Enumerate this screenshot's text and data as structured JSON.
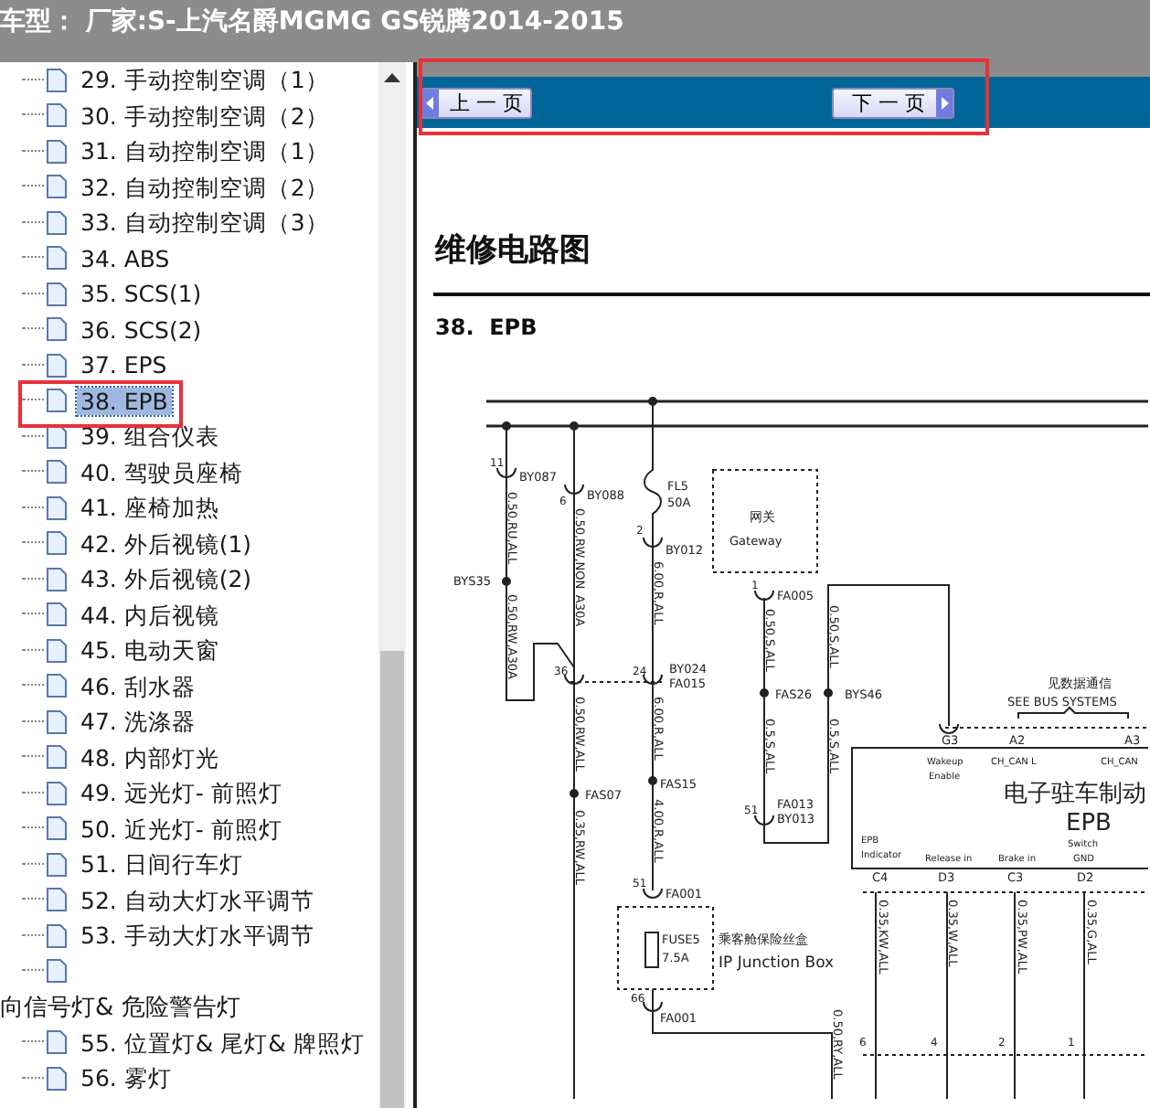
{
  "window": {
    "title": "车型： 厂家:S-上汽名爵MGMG GS锐腾2014-2015"
  },
  "tree": {
    "items": [
      {
        "label": "29. 手动控制空调（1）",
        "selected": false
      },
      {
        "label": "30. 手动控制空调（2）",
        "selected": false
      },
      {
        "label": "31. 自动控制空调（1）",
        "selected": false
      },
      {
        "label": "32. 自动控制空调（2）",
        "selected": false
      },
      {
        "label": "33. 自动控制空调（3）",
        "selected": false
      },
      {
        "label": "34. ABS",
        "selected": false
      },
      {
        "label": "35. SCS(1)",
        "selected": false
      },
      {
        "label": "36. SCS(2)",
        "selected": false
      },
      {
        "label": "37. EPS",
        "selected": false
      },
      {
        "label": "38. EPB",
        "selected": true
      },
      {
        "label": "39. 组合仪表",
        "selected": false
      },
      {
        "label": "40. 驾驶员座椅",
        "selected": false
      },
      {
        "label": "41. 座椅加热",
        "selected": false
      },
      {
        "label": "42. 外后视镜(1)",
        "selected": false
      },
      {
        "label": "43. 外后视镜(2)",
        "selected": false
      },
      {
        "label": "44. 内后视镜",
        "selected": false
      },
      {
        "label": "45. 电动天窗",
        "selected": false
      },
      {
        "label": "46. 刮水器",
        "selected": false
      },
      {
        "label": "47. 洗涤器",
        "selected": false
      },
      {
        "label": "48. 内部灯光",
        "selected": false
      },
      {
        "label": "49. 远光灯- 前照灯",
        "selected": false
      },
      {
        "label": "50. 近光灯- 前照灯",
        "selected": false
      },
      {
        "label": "51. 日间行车灯",
        "selected": false
      },
      {
        "label": "52. 自动大灯水平调节",
        "selected": false
      },
      {
        "label": "53. 手动大灯水平调节",
        "selected": false
      },
      {
        "selected": false
      },
      {
        "label": "向信号灯& 危险警告灯",
        "selected": false,
        "children": [
          {
            "label": "55. 位置灯& 尾灯& 牌照灯",
            "selected": false
          },
          {
            "label": "56. 雾灯",
            "selected": false
          }
        ]
      }
    ]
  },
  "nav": {
    "prev": "上 一 页",
    "next": "下 一 页"
  },
  "document": {
    "heading": "维修电路图",
    "section": "38.  EPB",
    "diagram": {
      "labels": [
        {
          "text": "11",
          "kind": "small"
        },
        {
          "text": "BY087",
          "kind": "plain"
        },
        {
          "text": "0.50,RU,ALL",
          "kind": "rot"
        },
        {
          "text": "BYS35",
          "kind": "plain"
        },
        {
          "text": "0.50,RW,A30A",
          "kind": "rot"
        },
        {
          "text": "6",
          "kind": "small"
        },
        {
          "text": "BY088",
          "kind": "plain"
        },
        {
          "text": "0.50,RW,NON_A30A",
          "kind": "rot"
        },
        {
          "text": "FL5",
          "kind": "plain"
        },
        {
          "text": "50A",
          "kind": "plain"
        },
        {
          "text": "2",
          "kind": "small"
        },
        {
          "text": "BY012",
          "kind": "plain"
        },
        {
          "text": "6.00,R,ALL",
          "kind": "rot"
        },
        {
          "text": "36",
          "kind": "small"
        },
        {
          "text": "24",
          "kind": "small"
        },
        {
          "text": "BY024",
          "kind": "plain"
        },
        {
          "text": "FA015",
          "kind": "plain"
        },
        {
          "text": "0.50,RW,ALL",
          "kind": "rot"
        },
        {
          "text": "6.00,R,ALL",
          "kind": "rot"
        },
        {
          "text": "FAS07",
          "kind": "plain"
        },
        {
          "text": "0.35,RW,ALL",
          "kind": "rot"
        },
        {
          "text": "FAS15",
          "kind": "plain"
        },
        {
          "text": "4.00,R,ALL",
          "kind": "rot"
        },
        {
          "text": "51",
          "kind": "small"
        },
        {
          "text": "FA001",
          "kind": "plain"
        },
        {
          "text": "FUSE5",
          "kind": "plain"
        },
        {
          "text": "7.5A",
          "kind": "plain"
        },
        {
          "text": "乘客舱保险丝盒",
          "kind": "cjk"
        },
        {
          "text": "IP Junction Box",
          "kind": "mid"
        },
        {
          "text": "66",
          "kind": "small"
        },
        {
          "text": "FA001",
          "kind": "plain"
        },
        {
          "text": "0.50,RY,ALL",
          "kind": "rot"
        },
        {
          "text": "网关",
          "kind": "cjk"
        },
        {
          "text": "Gateway",
          "kind": "plain"
        },
        {
          "text": "1",
          "kind": "small"
        },
        {
          "text": "FA005",
          "kind": "plain"
        },
        {
          "text": "0.50,S,ALL",
          "kind": "rot"
        },
        {
          "text": "FAS26",
          "kind": "plain"
        },
        {
          "text": "0.5,S,ALL",
          "kind": "rot"
        },
        {
          "text": "51",
          "kind": "small"
        },
        {
          "text": "FA013",
          "kind": "plain"
        },
        {
          "text": "BY013",
          "kind": "plain"
        },
        {
          "text": "0.50,S,ALL",
          "kind": "rot"
        },
        {
          "text": "BYS46",
          "kind": "plain"
        },
        {
          "text": "0.5,S,ALL",
          "kind": "rot"
        },
        {
          "text": "见数据通信",
          "kind": "cjk"
        },
        {
          "text": "SEE BUS SYSTEMS",
          "kind": "plain"
        },
        {
          "text": "G3",
          "kind": "plain"
        },
        {
          "text": "A2",
          "kind": "plain"
        },
        {
          "text": "A3",
          "kind": "plain"
        },
        {
          "text": "Wakeup",
          "kind": "tiny"
        },
        {
          "text": "Enable",
          "kind": "tiny"
        },
        {
          "text": "CH_CAN L",
          "kind": "tiny"
        },
        {
          "text": "CH_CAN",
          "kind": "tiny"
        },
        {
          "text": "电子驻车制动",
          "kind": "big"
        },
        {
          "text": "EPB",
          "kind": "big"
        },
        {
          "text": "EPB",
          "kind": "tiny"
        },
        {
          "text": "Indicator",
          "kind": "tiny"
        },
        {
          "text": "Release in",
          "kind": "tiny"
        },
        {
          "text": "Brake in",
          "kind": "tiny"
        },
        {
          "text": "Switch",
          "kind": "tiny"
        },
        {
          "text": "GND",
          "kind": "tiny"
        },
        {
          "text": "C4",
          "kind": "plain"
        },
        {
          "text": "D3",
          "kind": "plain"
        },
        {
          "text": "C3",
          "kind": "plain"
        },
        {
          "text": "D2",
          "kind": "plain"
        },
        {
          "text": "0.35,KW,ALL",
          "kind": "rot"
        },
        {
          "text": "0.35,W,ALL",
          "kind": "rot"
        },
        {
          "text": "0.35,PW,ALL",
          "kind": "rot"
        },
        {
          "text": "0.35,G,ALL",
          "kind": "rot"
        },
        {
          "text": "6",
          "kind": "small"
        },
        {
          "text": "4",
          "kind": "small"
        },
        {
          "text": "2",
          "kind": "small"
        },
        {
          "text": "1",
          "kind": "small"
        }
      ]
    }
  }
}
